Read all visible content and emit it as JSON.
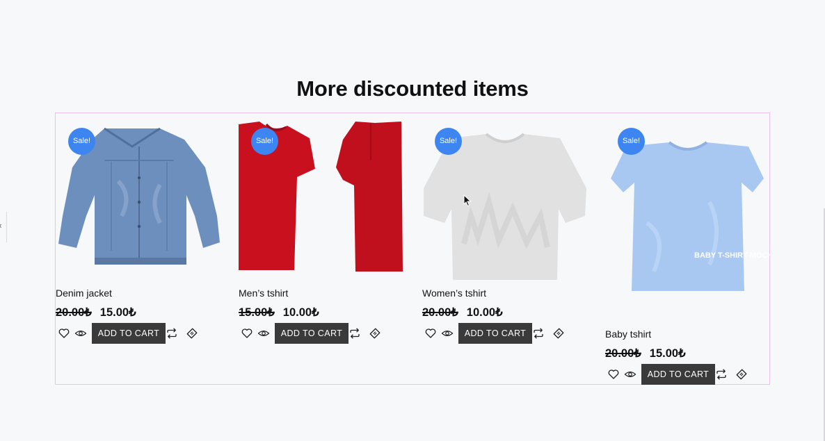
{
  "section_title": "More discounted items",
  "currency_symbol": "₺",
  "products": [
    {
      "name": "Denim jacket",
      "badge": "Sale!",
      "old_price": "20.00₺",
      "new_price": "15.00₺",
      "add_to_cart": "ADD TO CART",
      "image": "denim-jacket"
    },
    {
      "name": "Men’s tshirt",
      "badge": "Sale!",
      "old_price": "15.00₺",
      "new_price": "10.00₺",
      "add_to_cart": "ADD TO CART",
      "image": "mens-red-tshirt"
    },
    {
      "name": "Women’s tshirt",
      "badge": "Sale!",
      "old_price": "20.00₺",
      "new_price": "10.00₺",
      "add_to_cart": "ADD TO CART",
      "image": "womens-white-tshirt"
    },
    {
      "name": "Baby tshirt",
      "badge": "Sale!",
      "old_price": "20.00₺",
      "new_price": "15.00₺",
      "add_to_cart": "ADD TO CART",
      "image": "baby-blue-tshirt",
      "image_text": "BABY T-SHIRT MOCKUP"
    }
  ],
  "icons": {
    "wishlist": "heart-icon",
    "quick_view": "eye-icon",
    "compare": "compare-arrows-icon",
    "discount": "tag-icon"
  },
  "colors": {
    "badge": "#3d86f2",
    "button": "#3a3a3a",
    "grid_border": "#f0bff0",
    "background": "#f7f8fa"
  }
}
